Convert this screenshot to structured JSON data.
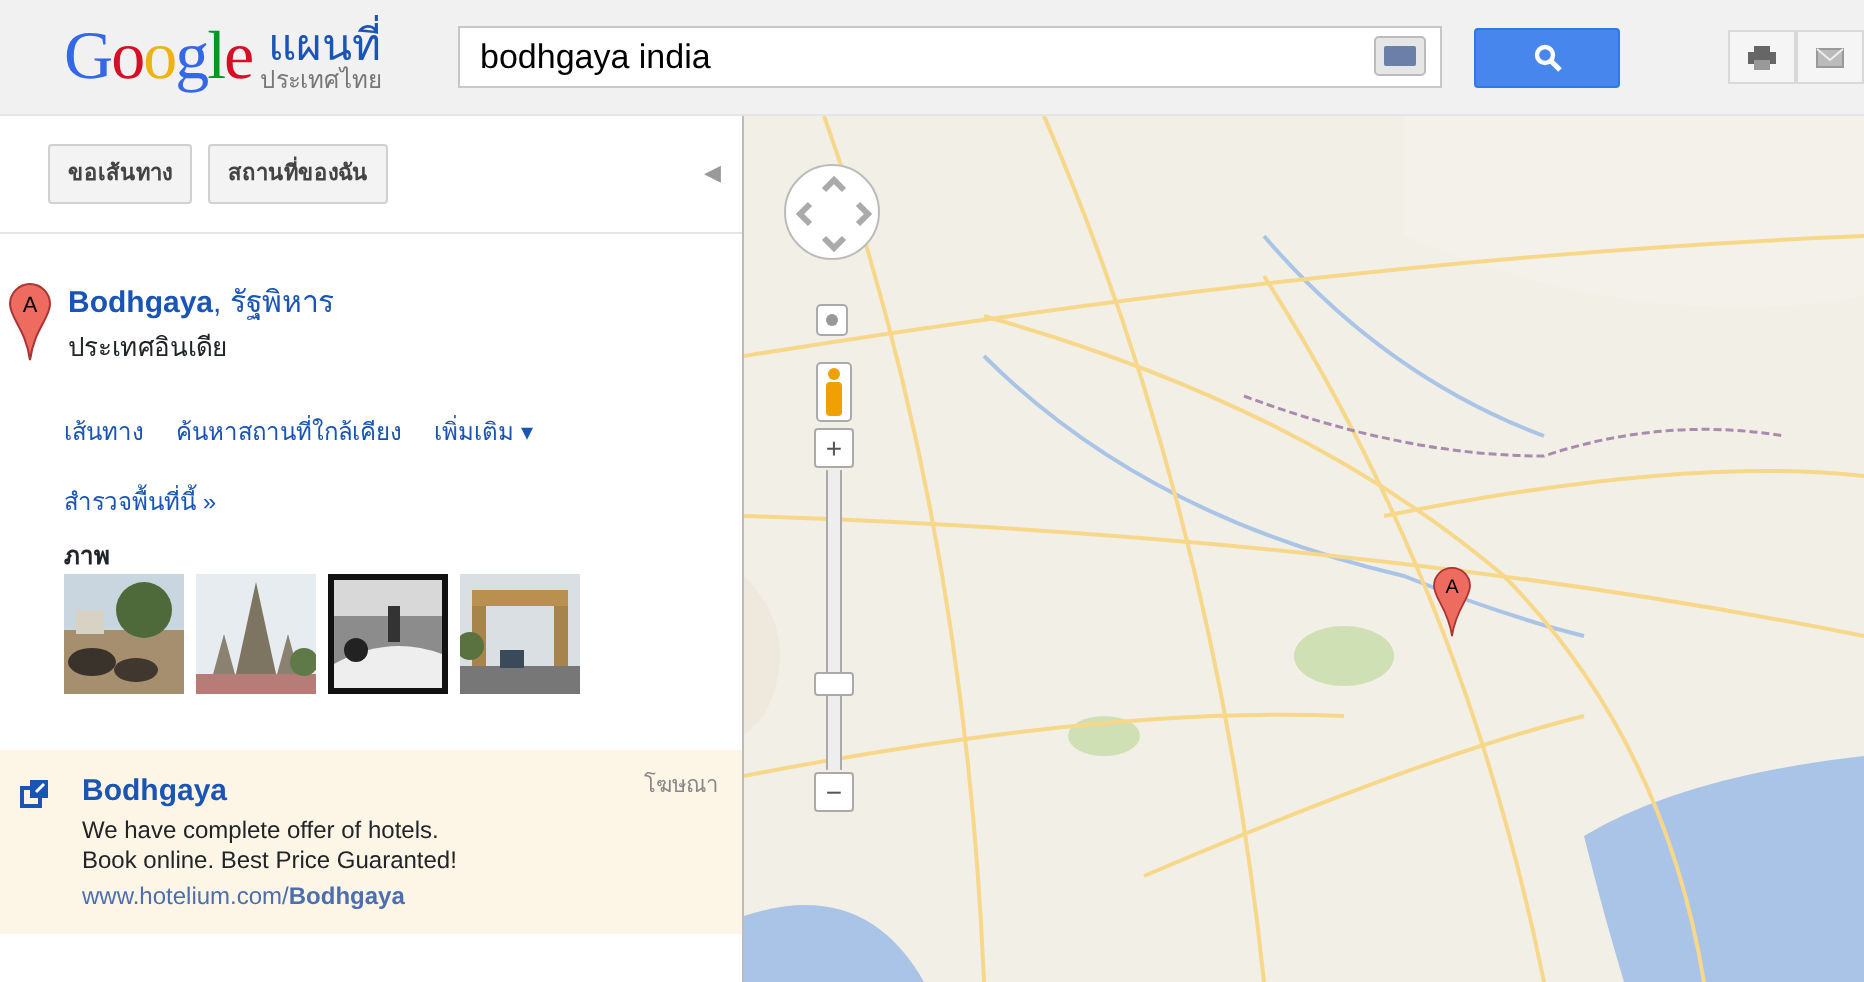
{
  "header": {
    "logo": "Google",
    "product": "แผนที่",
    "region": "ประเทศไทย",
    "search": {
      "value": "bodhgaya india"
    }
  },
  "toolbar": {
    "buttons": [
      "ขอเส้นทาง",
      "สถานที่ของฉัน"
    ],
    "collapse": "◀"
  },
  "result": {
    "marker_label": "A",
    "title": "Bodhgaya",
    "title_suffix": ", รัฐพิหาร",
    "subtitle": "ประเทศอินเดีย",
    "links": [
      "เส้นทาง",
      "ค้นหาสถานที่ใกล้เคียง",
      "เพิ่มเติม ▾"
    ],
    "explore": "สำรวจพื้นที่นี้ »",
    "photos_label": "ภาพ",
    "photos": [
      {
        "kind": "picture"
      },
      {
        "kind": "picture"
      },
      {
        "kind": "picture"
      },
      {
        "kind": "picture"
      }
    ]
  },
  "ad": {
    "title": "Bodhgaya",
    "tag": "โฆษณา",
    "lines": [
      "We have complete offer of hotels.",
      "Book online. Best Price Guaranted!"
    ],
    "url": "www.hotelium.com/**Bodhgaya**"
  },
  "map": {
    "marker_label": "A",
    "zoom": {
      "plus": "+",
      "minus": "−",
      "level": 0.27
    }
  }
}
